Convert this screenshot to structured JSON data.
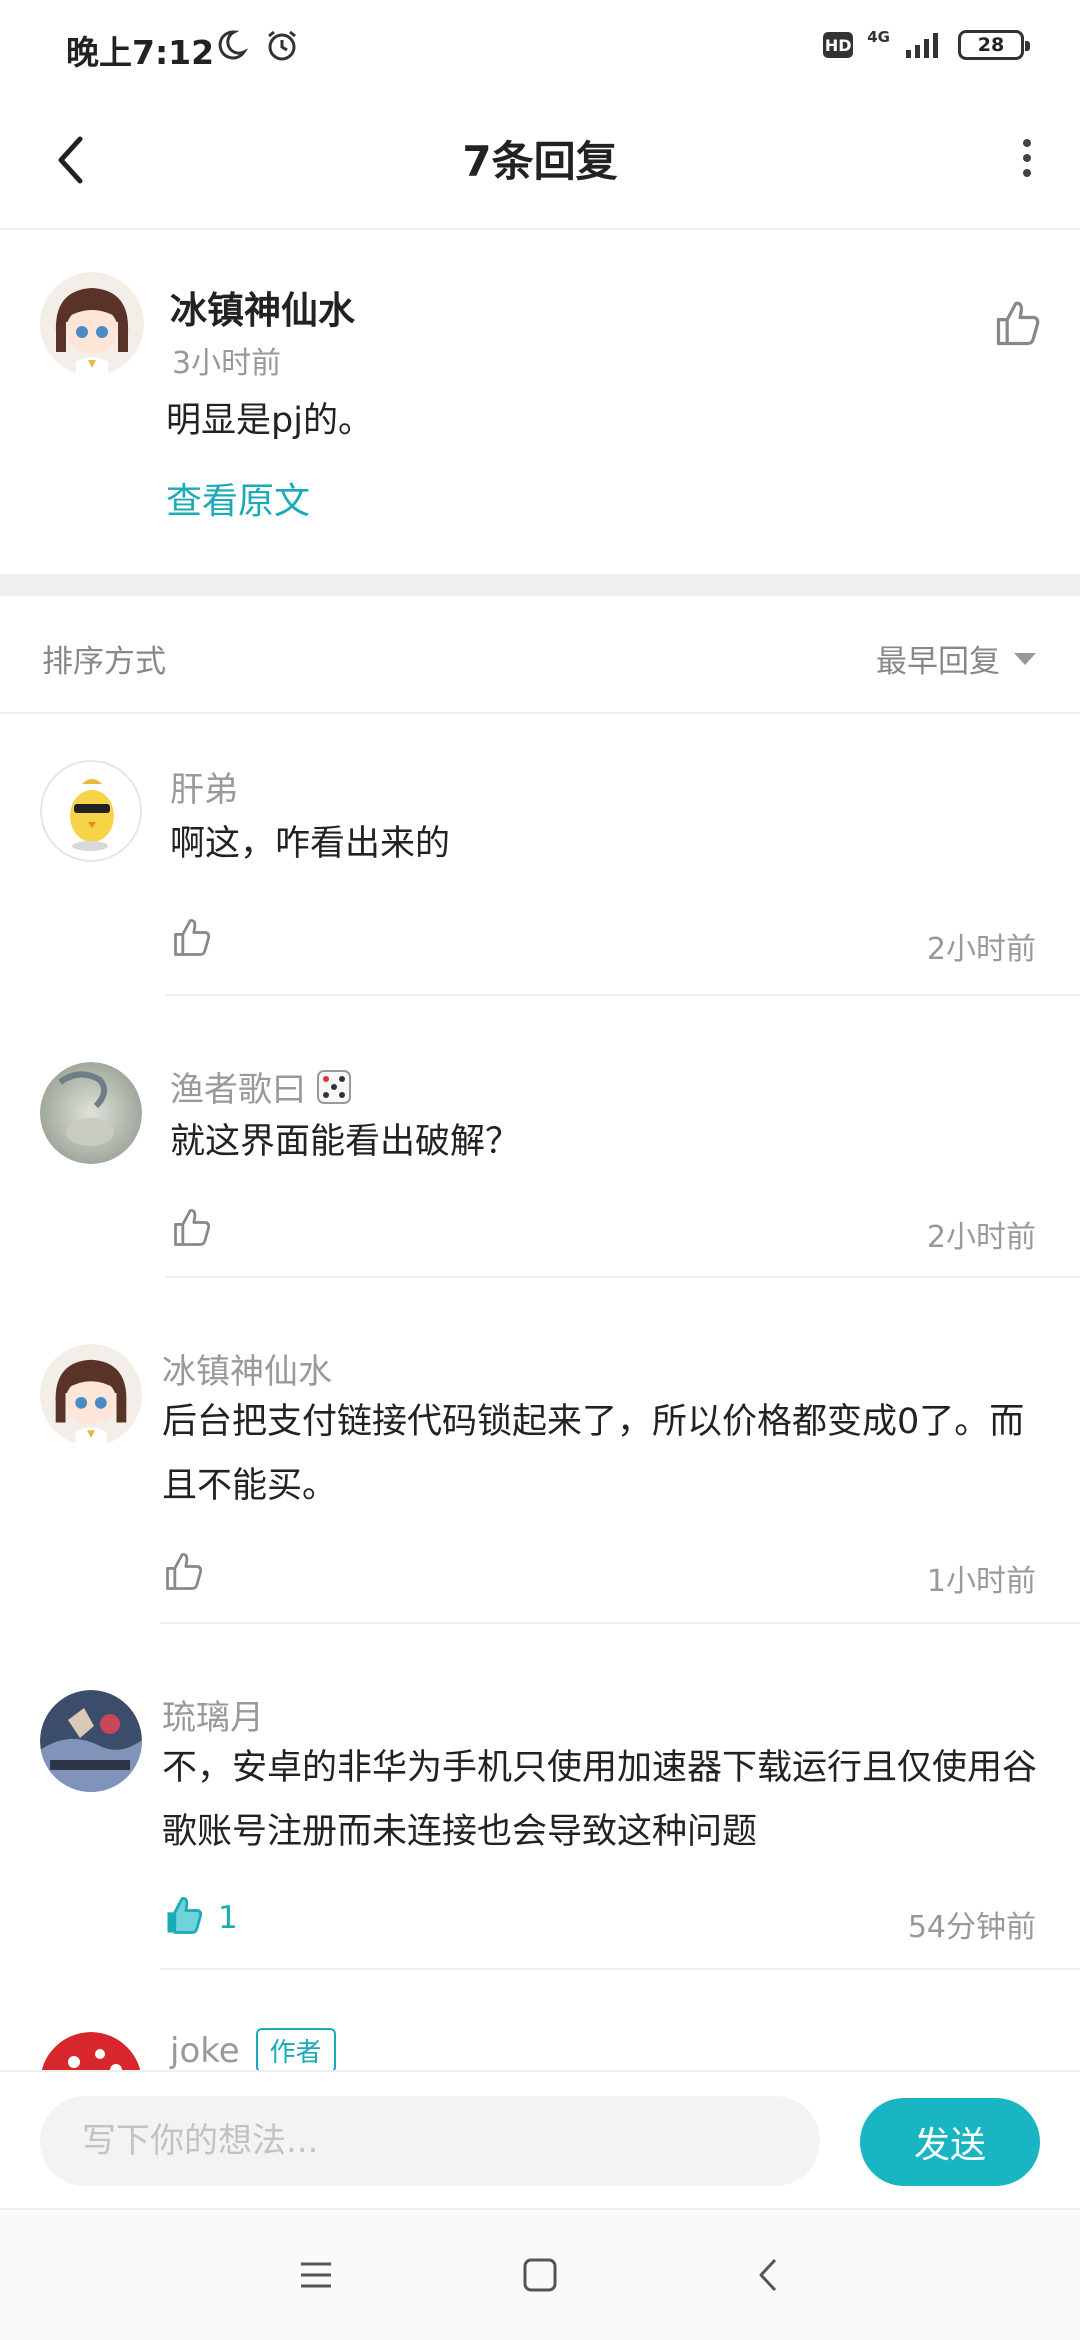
{
  "status_bar": {
    "time": "晚上7:12",
    "icons": [
      "moon-icon",
      "alarm-icon"
    ],
    "hd": "HD",
    "network": "4G",
    "battery": "28"
  },
  "header": {
    "title": "7条回复"
  },
  "original": {
    "author": "冰镇神仙水",
    "time": "3小时前",
    "text": "明显是pj的。",
    "view_original": "查看原文"
  },
  "sort": {
    "label": "排序方式",
    "selected": "最早回复"
  },
  "replies": [
    {
      "name": "肝弟",
      "text": "啊这，咋看出来的",
      "time": "2小时前",
      "likes": "",
      "liked": false
    },
    {
      "name": "渔者歌曰",
      "text": "就这界面能看出破解？",
      "time": "2小时前",
      "likes": "",
      "liked": false
    },
    {
      "name": "冰镇神仙水",
      "text": "后台把支付链接代码锁起来了，所以价格都变成0了。而且不能买。",
      "time": "1小时前",
      "likes": "",
      "liked": false
    },
    {
      "name": "琉璃月",
      "text": "不，安卓的非华为手机只使用加速器下载运行且仅使用谷歌账号注册而未连接也会导致这种问题",
      "time": "54分钟前",
      "likes": "1",
      "liked": true
    },
    {
      "name": "joke",
      "badge": "作者"
    }
  ],
  "input": {
    "placeholder": "写下你的想法...",
    "send": "发送"
  },
  "colors": {
    "accent": "#1aaab8",
    "send_button": "#1ab5c2",
    "muted_text": "#999999"
  }
}
